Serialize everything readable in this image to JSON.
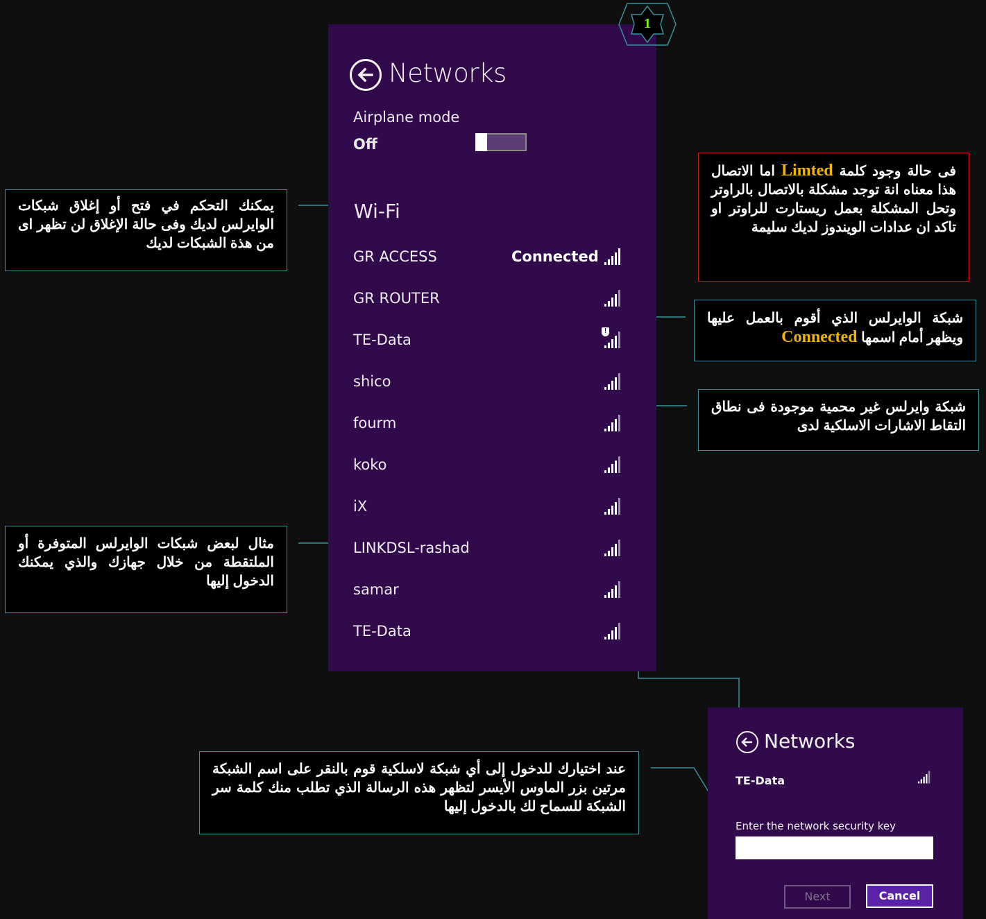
{
  "badge": "1",
  "networks_panel": {
    "title": "Networks",
    "airplane_label": "Airplane mode",
    "airplane_state": "Off",
    "wifi_label": "Wi-Fi",
    "networks": [
      {
        "name": "GR ACCESS",
        "status": "Connected",
        "icon": "wifi-signal-icon"
      },
      {
        "name": "GR ROUTER",
        "status": "",
        "icon": "wifi-signal-icon"
      },
      {
        "name": "TE-Data",
        "status": "",
        "icon": "wifi-unsecured-signal-icon"
      },
      {
        "name": "shico",
        "status": "",
        "icon": "wifi-signal-icon"
      },
      {
        "name": "fourm",
        "status": "",
        "icon": "wifi-signal-icon"
      },
      {
        "name": "koko",
        "status": "",
        "icon": "wifi-signal-icon"
      },
      {
        "name": "iX",
        "status": "",
        "icon": "wifi-signal-icon"
      },
      {
        "name": "LINKDSL-rashad",
        "status": "",
        "icon": "wifi-signal-icon"
      },
      {
        "name": "samar",
        "status": "",
        "icon": "wifi-signal-icon"
      },
      {
        "name": "TE-Data",
        "status": "",
        "icon": "wifi-signal-icon"
      }
    ]
  },
  "notes": {
    "airplane": "يمكنك التحكم في فتح أو إغلاق شبكات الوايرلس لديك وفى حالة الإغلاق لن تظهر اى من هذة الشبكات لديك",
    "list": "مثال لبعض شبكات الوايرلس المتوفرة أو الملتقطة من خلال جهازك والذي يمكنك الدخول إليها",
    "limited_pre": "فى حالة وجود كلمة",
    "limited_word": "Limted",
    "limited_post": "اما الاتصال هذا معناه انة توجد مشكلة بالاتصال بالراوتر وتحل المشكلة بعمل ريستارت للراوتر او تاكد ان عدادات الويندوز لديك سليمة",
    "connected_pre": "شبكة الوايرلس الذي أقوم بالعمل عليها ويظهر أمام اسمها",
    "connected_word": "Connected",
    "unsecured": "شبكة وايرلس غير محمية موجودة فى نطاق التقاط الاشارات الاسلكية لدى",
    "password": "عند اختيارك للدخول إلى أي شبكة لاسلكية قوم بالنقر على اسم الشبكة مرتين بزر الماوس الأيسر لتظهر هذه الرسالة الذي تطلب منك كلمة سر الشبكة للسماح لك بالدخول إليها"
  },
  "key_dialog": {
    "title": "Networks",
    "network": "TE-Data",
    "key_label": "Enter the network security key",
    "key_value": "",
    "next": "Next",
    "cancel": "Cancel"
  },
  "colors": {
    "panel": "#300a4a",
    "background": "#0f0f0f",
    "note_border": "#3a8f9a",
    "warning_border": "#d01010",
    "highlight": "#f1b400"
  }
}
